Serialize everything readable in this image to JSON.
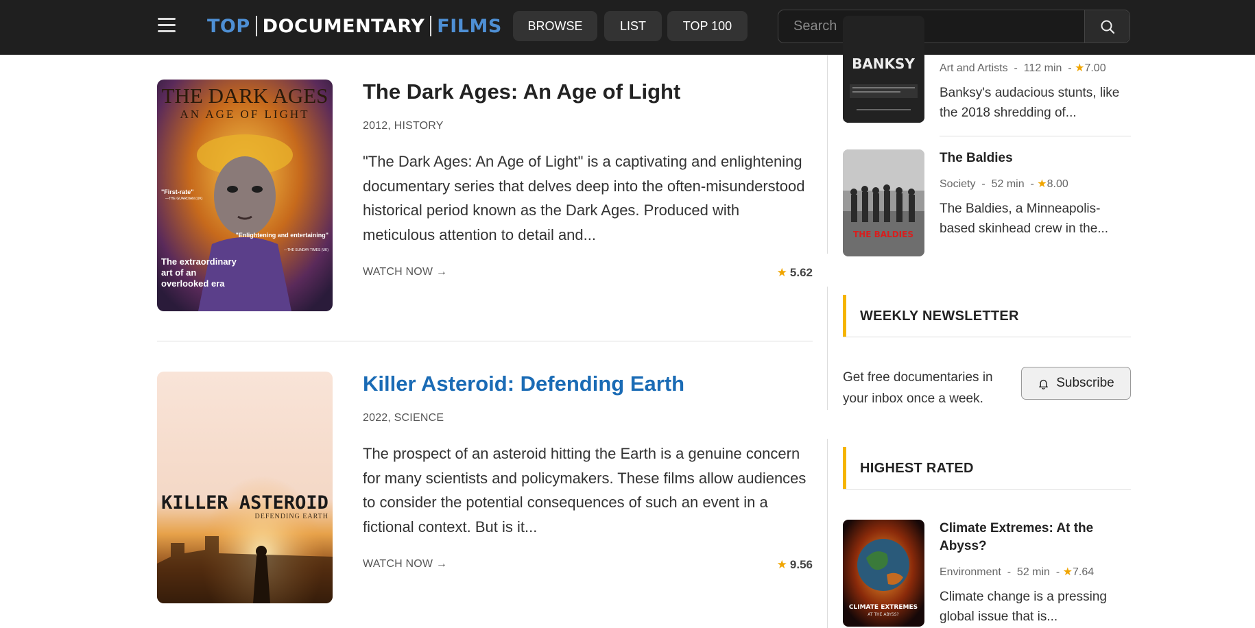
{
  "header": {
    "logo": {
      "top": "TOP",
      "documentary": "DOCUMENTARY",
      "films": "FILMS"
    },
    "nav": [
      "BROWSE",
      "LIST",
      "TOP 100"
    ],
    "search_placeholder": "Search"
  },
  "articles": [
    {
      "title": "The Dark Ages: An Age of Light",
      "meta": "2012, HISTORY",
      "description": "\"The Dark Ages: An Age of Light\" is a captivating and enlightening documentary series that delves deep into the often-misunderstood historical period known as the Dark Ages. Produced with meticulous attention to detail and...",
      "watch_label": "WATCH NOW →",
      "rating": "5.62",
      "poster": {
        "heading_1": "THE DARK AGES",
        "heading_2": "AN AGE OF LIGHT",
        "quote_1": "\"First-rate\"",
        "quote_1_source": "—THE GUARDIAN (UK)",
        "quote_2": "\"Enlightening and entertaining\"",
        "quote_2_source": "—THE SUNDAY TIMES (UK)",
        "tagline": "The extraordinary art of an overlooked era"
      }
    },
    {
      "title": "Killer Asteroid: Defending Earth",
      "meta": "2022, SCIENCE",
      "description": "The prospect of an asteroid hitting the Earth is a genuine concern for many scientists and policymakers. These films allow audiences to consider the potential consequences of such an event in a fictional context. But is it...",
      "watch_label": "WATCH NOW →",
      "rating": "9.56",
      "poster": {
        "heading": "KILLER ASTEROID",
        "subheading": "DEFENDING EARTH"
      }
    }
  ],
  "sidebar": {
    "top_items": [
      {
        "title": "",
        "meta": "Art and Artists  -  112 min  -",
        "rating": "7.00",
        "description": "Banksy's audacious stunts, like the 2018 shredding of...",
        "poster_text": "BANKSY"
      },
      {
        "title": "The Baldies",
        "meta": "Society  -  52 min  -",
        "rating": "8.00",
        "description": "The Baldies, a Minneapolis-based skinhead crew in the...",
        "poster_text": "THE BALDIES"
      }
    ],
    "newsletter": {
      "heading": "WEEKLY NEWSLETTER",
      "text": "Get free documentaries in your inbox once a week.",
      "button": "Subscribe"
    },
    "highest_rated": {
      "heading": "HIGHEST RATED",
      "items": [
        {
          "title": "Climate Extremes: At the Abyss?",
          "meta": "Environment  -  52 min  -",
          "rating": "7.64",
          "description": "Climate change is a pressing global issue that is...",
          "poster_title": "CLIMATE EXTREMES",
          "poster_sub": "AT THE ABYSS?"
        }
      ]
    }
  },
  "colors": {
    "accent_blue": "#4e8fd4",
    "link_blue": "#1a6bb5",
    "star": "#f0a500",
    "section_bar": "#f5b400"
  }
}
